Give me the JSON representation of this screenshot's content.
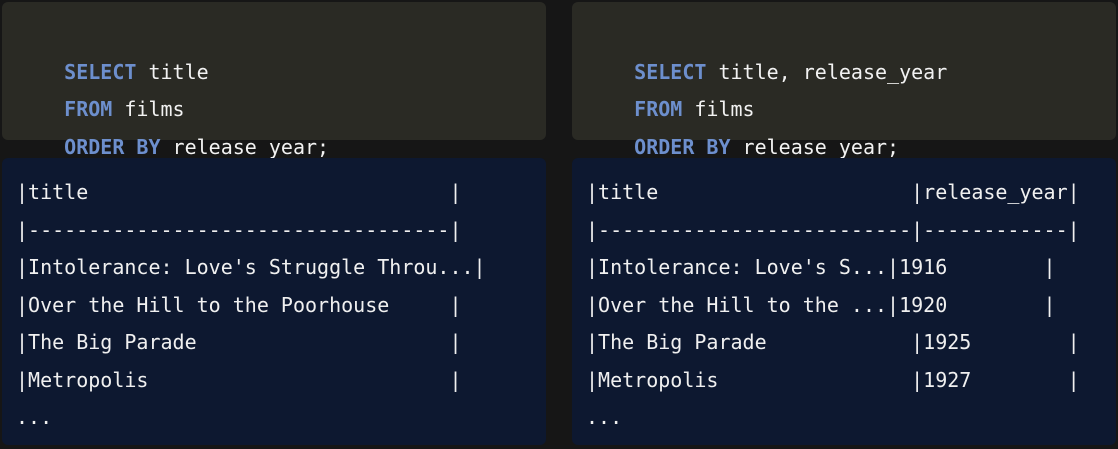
{
  "left": {
    "query": {
      "line1_kw": "SELECT",
      "line1_rest": " title",
      "line2_kw": "FROM",
      "line2_rest": " films",
      "line3_kw": "ORDER BY",
      "line3_rest": " release_year;"
    },
    "result_lines": [
      "|title                              |",
      "|-----------------------------------|",
      "|Intolerance: Love's Struggle Throu...|",
      "|Over the Hill to the Poorhouse     |",
      "|The Big Parade                     |",
      "|Metropolis                         |",
      "..."
    ]
  },
  "right": {
    "query": {
      "line1_kw": "SELECT",
      "line1_rest": " title, release_year",
      "line2_kw": "FROM",
      "line2_rest": " films",
      "line3_kw": "ORDER BY",
      "line3_rest": " release_year;"
    },
    "result_lines": [
      "|title                     |release_year|",
      "|--------------------------|------------|",
      "|Intolerance: Love's S...|1916        |",
      "|Over the Hill to the ...|1920        |",
      "|The Big Parade            |1925        |",
      "|Metropolis                |1927        |",
      "..."
    ]
  },
  "colors": {
    "keyword": "#6d8fcd",
    "code_bg": "#2a2a24",
    "result_bg": "#0d1830",
    "page_bg": "#161616"
  }
}
